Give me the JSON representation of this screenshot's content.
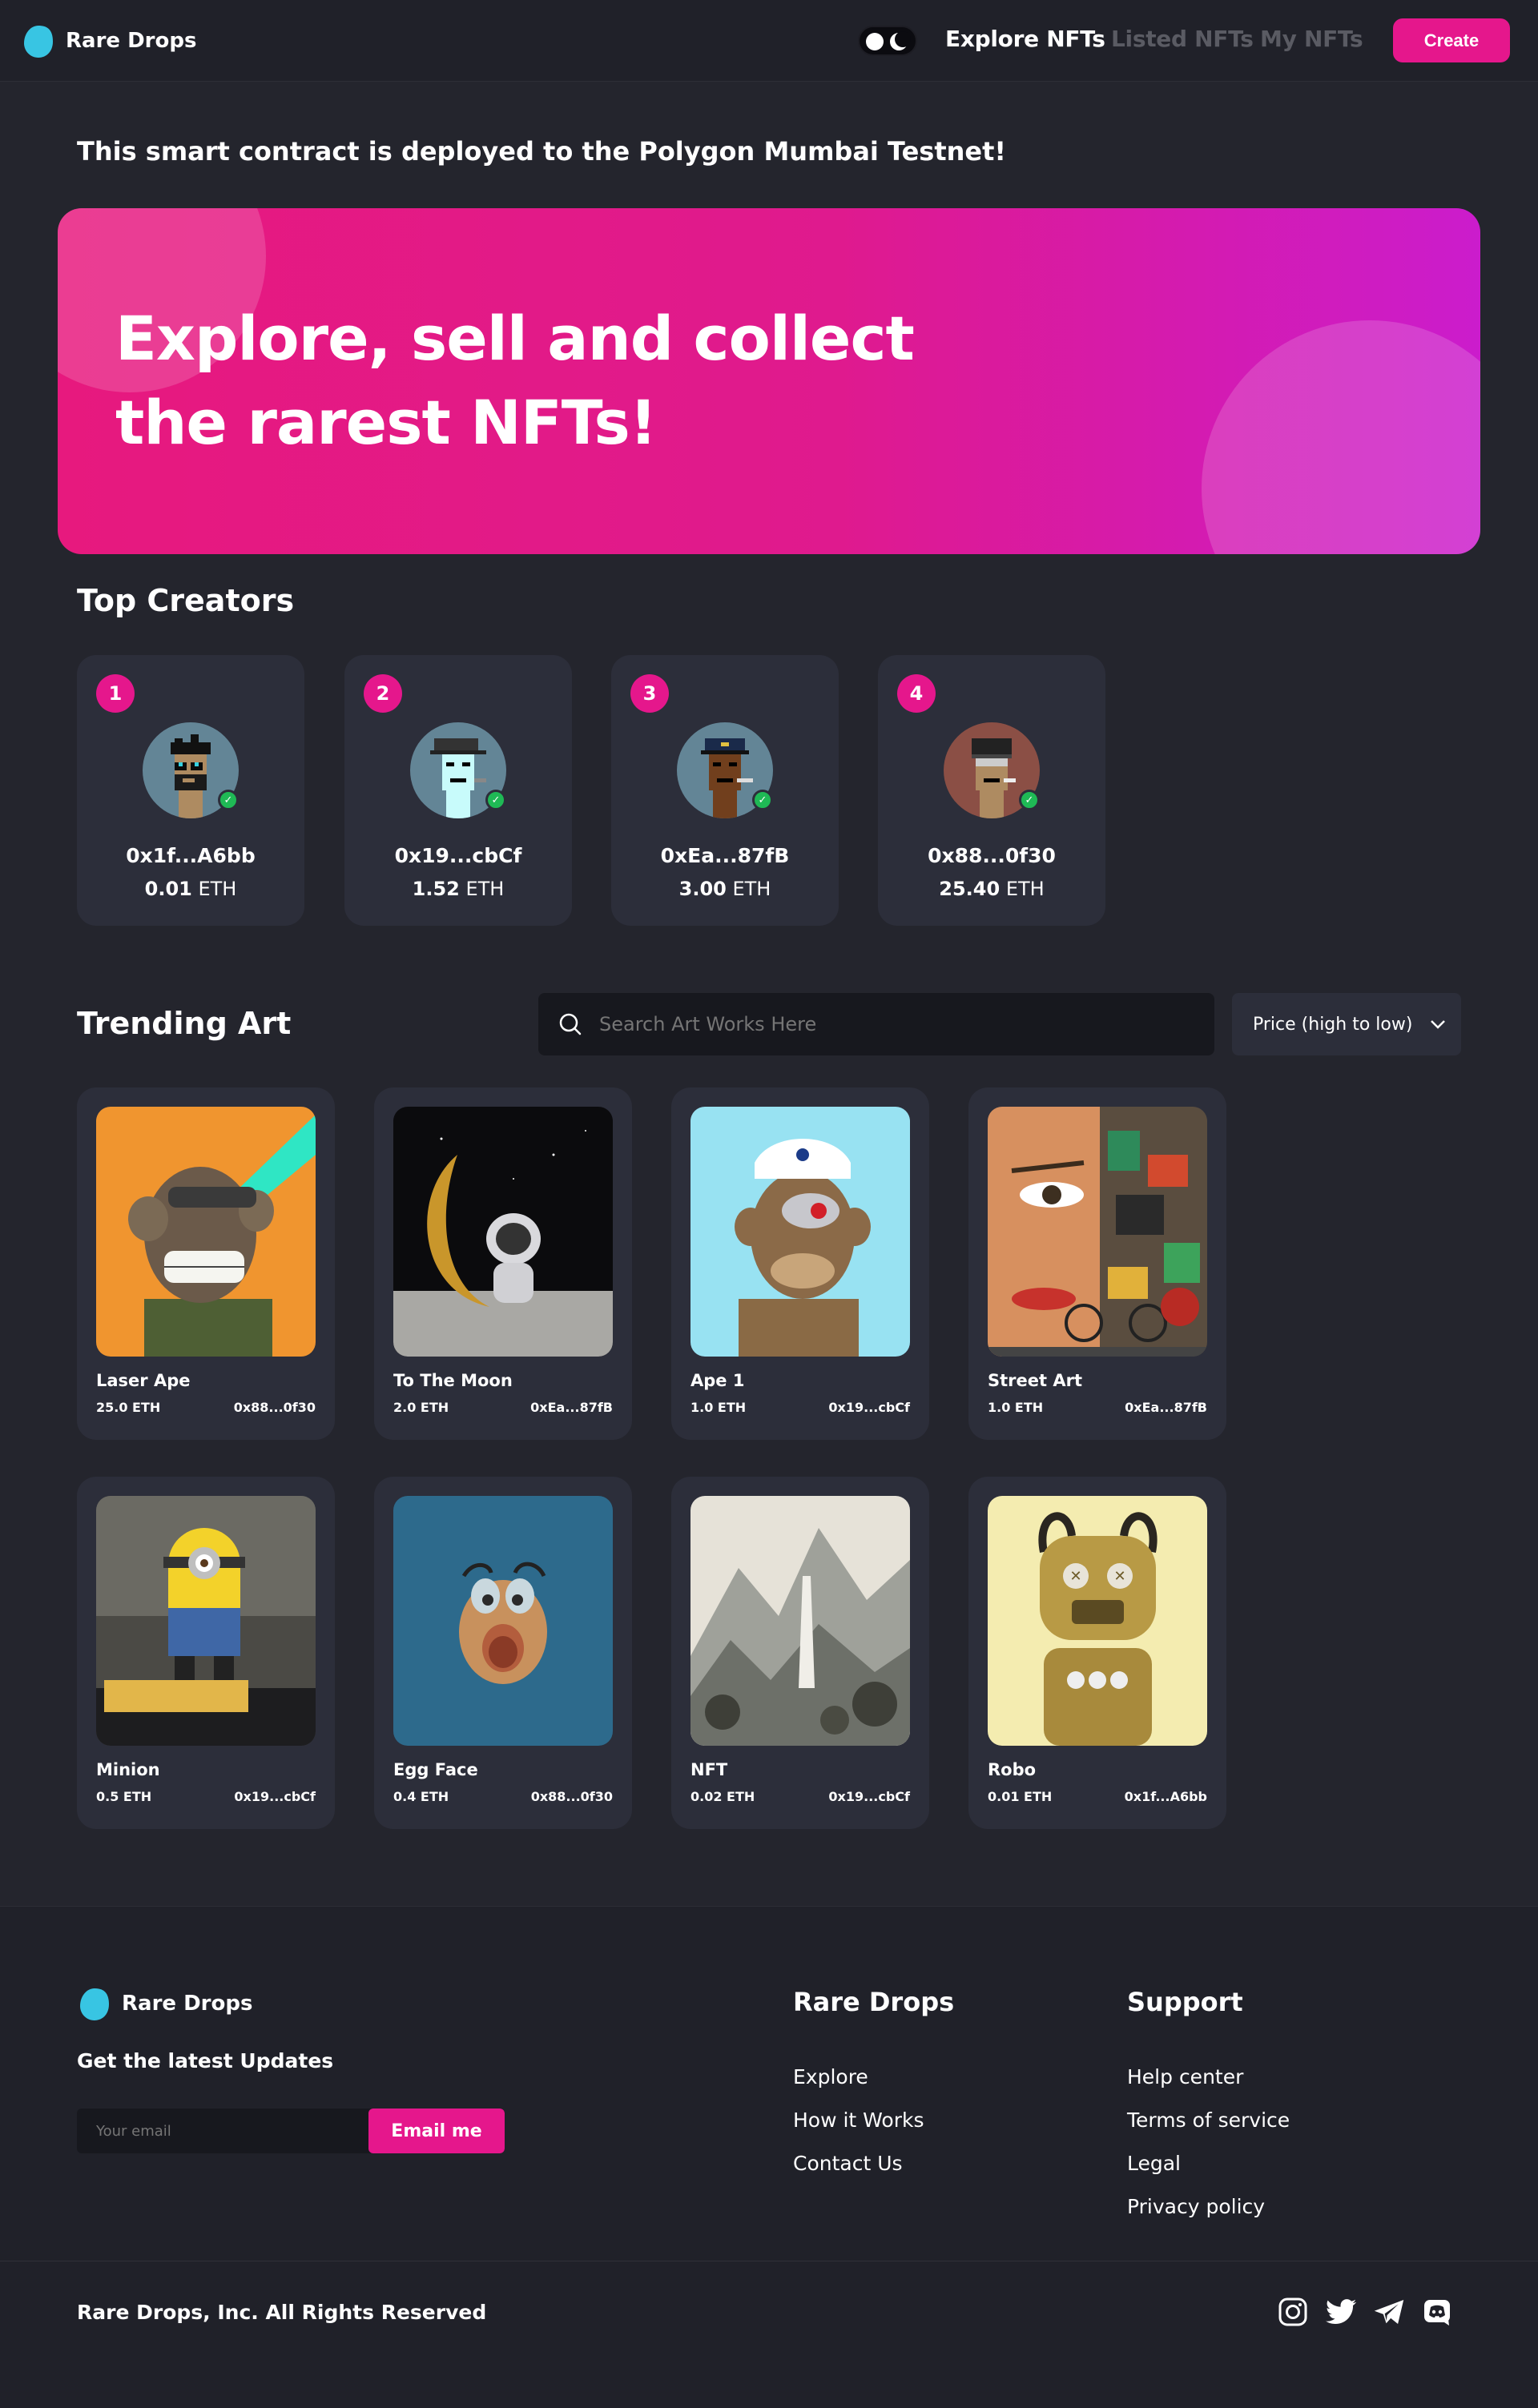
{
  "nav": {
    "brand": "Rare Drops",
    "links": [
      "Explore NFTs",
      "Listed NFTs",
      "My NFTs"
    ],
    "create_label": "Create"
  },
  "notice": "This smart contract is deployed to the Polygon Mumbai Testnet!",
  "hero": {
    "line1": "Explore, sell and collect",
    "line2": "the rarest NFTs!"
  },
  "top_creators": {
    "title": "Top Creators",
    "items": [
      {
        "rank": "1",
        "address": "0x1f...A6bb",
        "amount": "0.01",
        "unit": "ETH"
      },
      {
        "rank": "2",
        "address": "0x19...cbCf",
        "amount": "1.52",
        "unit": "ETH"
      },
      {
        "rank": "3",
        "address": "0xEa...87fB",
        "amount": "3.00",
        "unit": "ETH"
      },
      {
        "rank": "4",
        "address": "0x88...0f30",
        "amount": "25.40",
        "unit": "ETH"
      }
    ]
  },
  "trending": {
    "title": "Trending Art",
    "search_placeholder": "Search Art Works Here",
    "sort_label": "Price (high to low)",
    "items": [
      {
        "name": "Laser Ape",
        "price": "25.0 ETH",
        "owner": "0x88...0f30"
      },
      {
        "name": "To The Moon",
        "price": "2.0 ETH",
        "owner": "0xEa...87fB"
      },
      {
        "name": "Ape 1",
        "price": "1.0 ETH",
        "owner": "0x19...cbCf"
      },
      {
        "name": "Street Art",
        "price": "1.0 ETH",
        "owner": "0xEa...87fB"
      },
      {
        "name": "Minion",
        "price": "0.5 ETH",
        "owner": "0x19...cbCf"
      },
      {
        "name": "Egg Face",
        "price": "0.4 ETH",
        "owner": "0x88...0f30"
      },
      {
        "name": "NFT",
        "price": "0.02 ETH",
        "owner": "0x19...cbCf"
      },
      {
        "name": "Robo",
        "price": "0.01 ETH",
        "owner": "0x1f...A6bb"
      }
    ]
  },
  "footer": {
    "brand": "Rare Drops",
    "updates_label": "Get the latest Updates",
    "email_placeholder": "Your email",
    "email_button": "Email me",
    "col1": {
      "title": "Rare Drops",
      "links": [
        "Explore",
        "How it Works",
        "Contact Us"
      ]
    },
    "col2": {
      "title": "Support",
      "links": [
        "Help center",
        "Terms of service",
        "Legal",
        "Privacy policy"
      ]
    },
    "copyright": "Rare Drops, Inc. All Rights Reserved",
    "socials": [
      "instagram-icon",
      "twitter-icon",
      "telegram-icon",
      "discord-icon"
    ]
  },
  "colors": {
    "accent": "#e5178c",
    "background": "#24252d",
    "card": "#2c2e3a",
    "verified": "#1fb955"
  }
}
